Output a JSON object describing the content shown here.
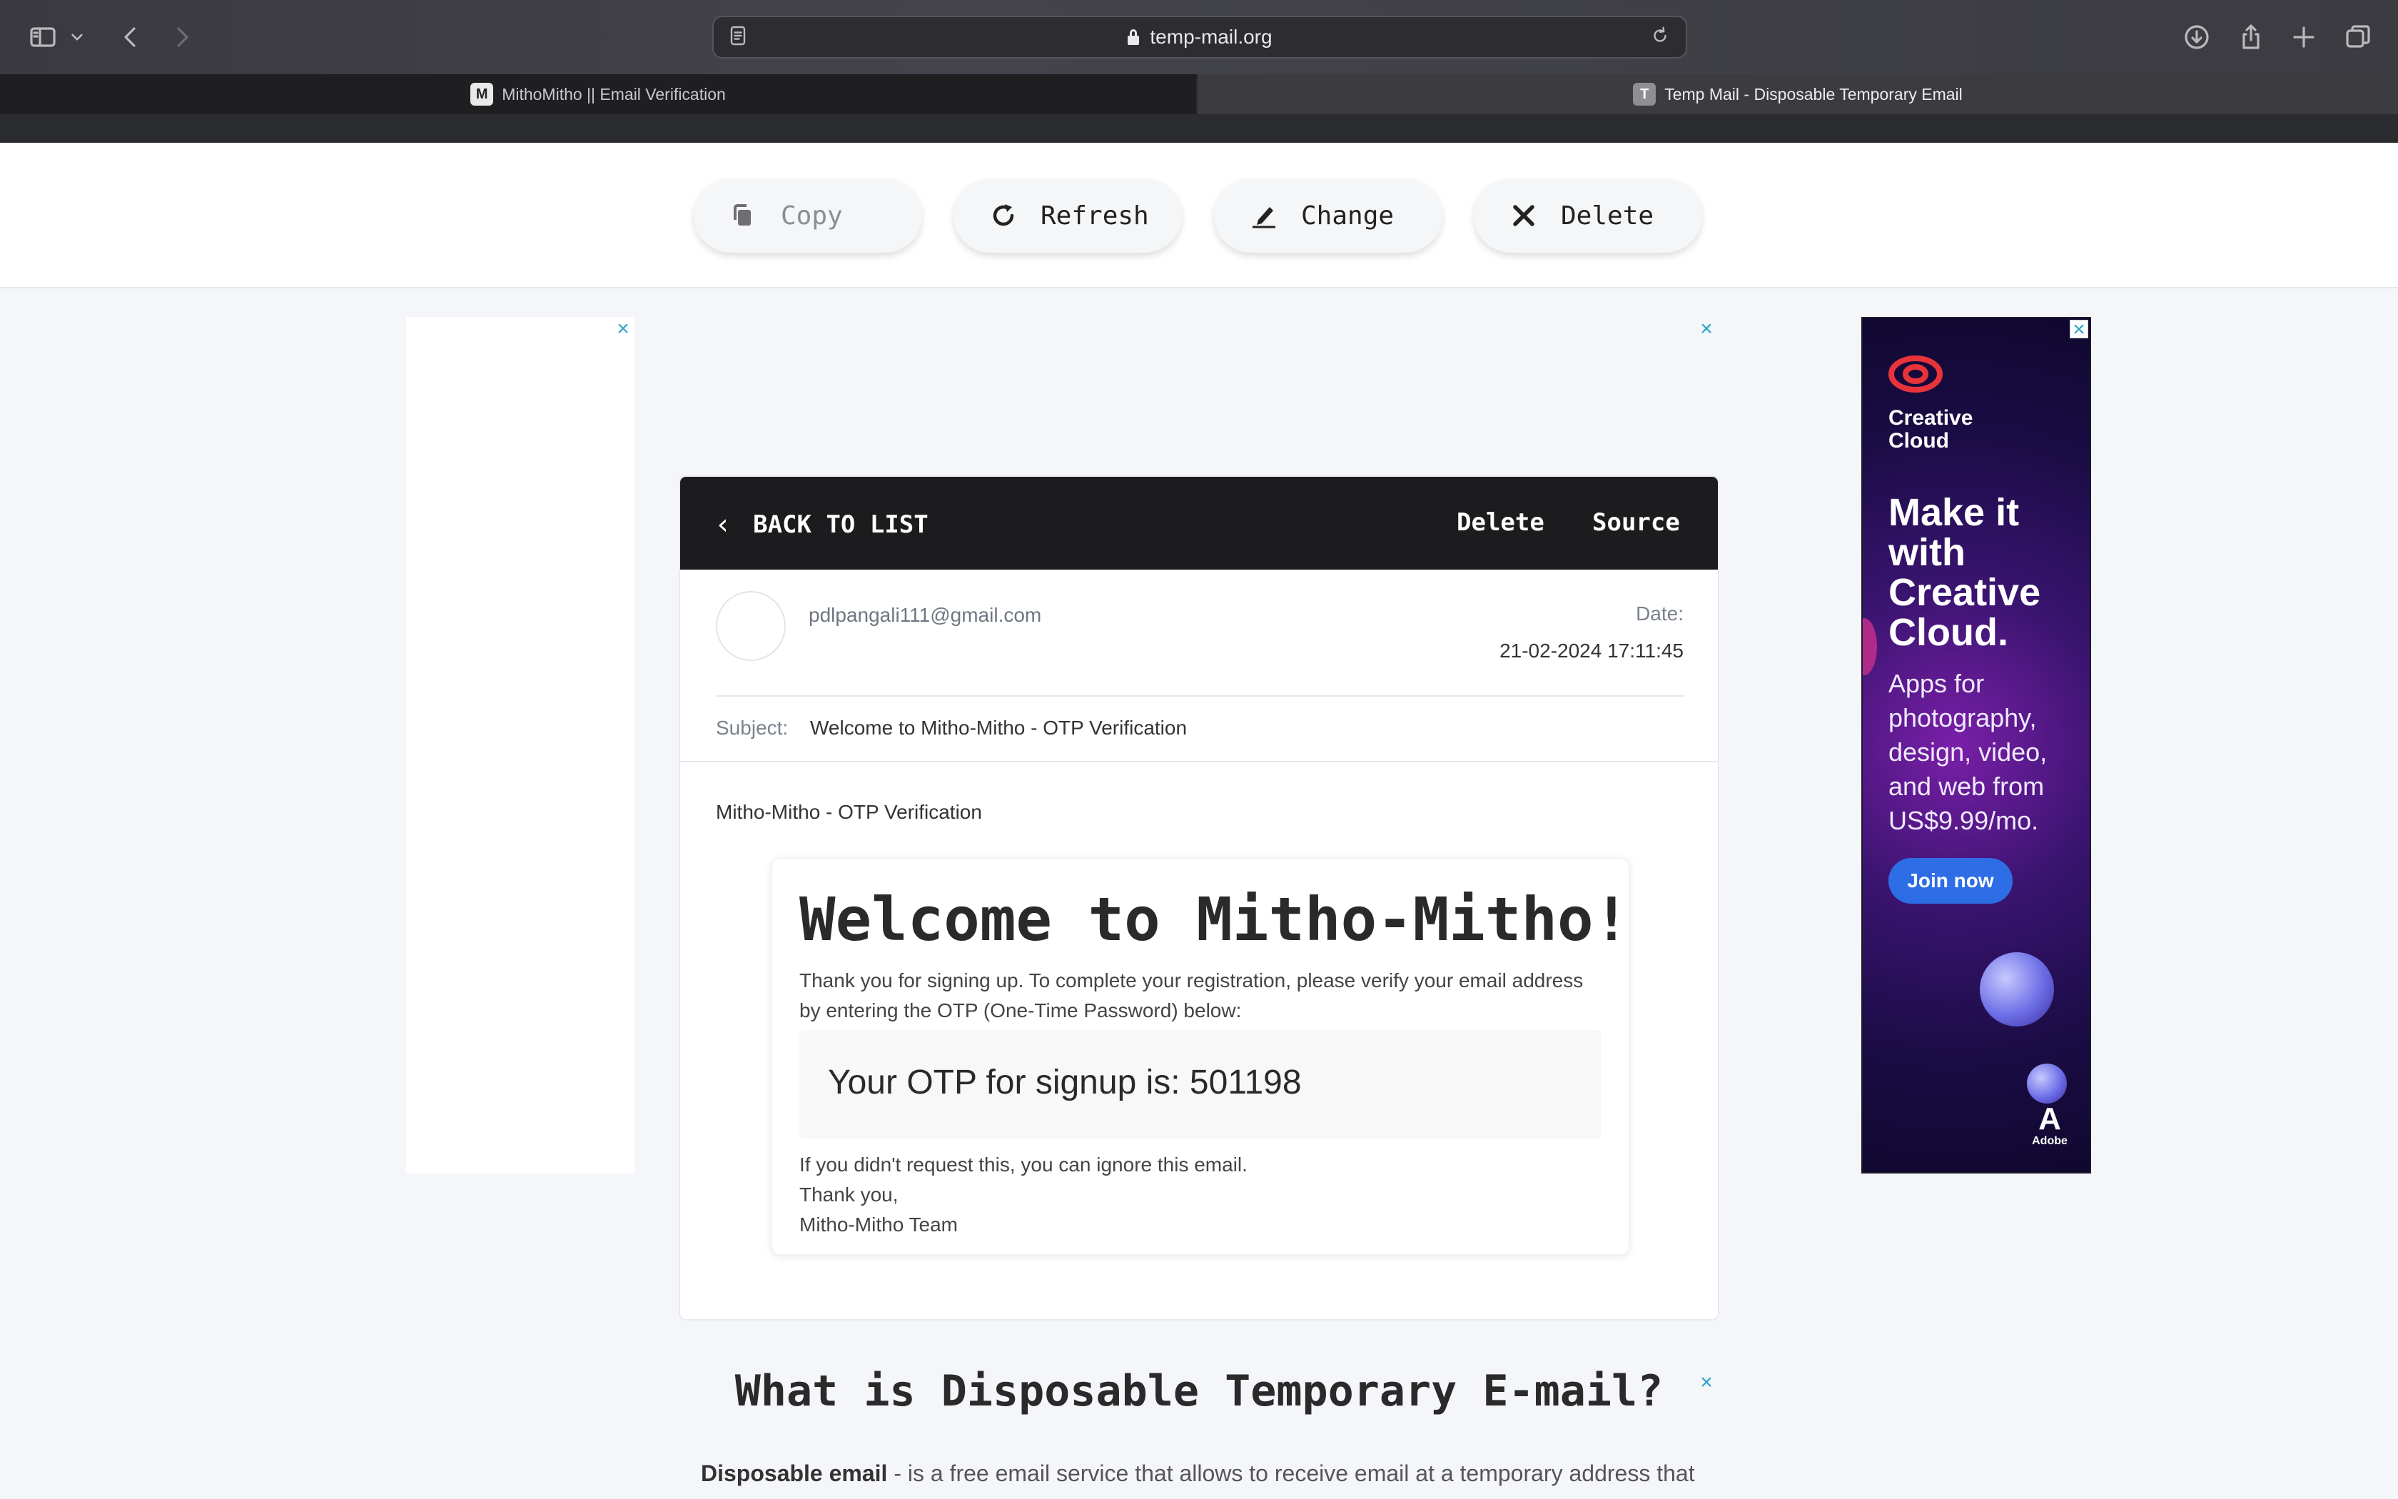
{
  "browser": {
    "url": "temp-mail.org",
    "tabs": [
      {
        "label": "MithoMitho || Email Verification",
        "favicon": "M"
      },
      {
        "label": "Temp Mail - Disposable Temporary Email",
        "favicon": "T"
      }
    ],
    "icons": {
      "sidebar": "sidebar-icon",
      "back": "back-arrow-icon",
      "forward": "forward-arrow-icon",
      "reader": "reader-icon",
      "reload": "reload-icon",
      "download": "download-icon",
      "share": "share-icon",
      "new_tab": "plus-icon",
      "tab_overview": "tabs-icon"
    }
  },
  "actions": {
    "copy": "Copy",
    "refresh": "Refresh",
    "change": "Change",
    "delete": "Delete"
  },
  "mail": {
    "back_label": "BACK TO LIST",
    "delete_label": "Delete",
    "source_label": "Source",
    "sender": "pdlpangali111@gmail.com",
    "date_label": "Date:",
    "date_value": "21-02-2024 17:11:45",
    "subject_label": "Subject:",
    "subject_value": "Welcome to Mitho-Mitho - OTP Verification",
    "preheader": "Mitho-Mitho - OTP Verification",
    "body": {
      "heading": "Welcome to Mitho-Mitho!",
      "intro": "Thank you for signing up. To complete your registration, please verify your email address by entering the OTP (One-Time Password) below:",
      "otp": "Your OTP for signup is: 501198",
      "outro_1": "If you didn't request this, you can ignore this email.",
      "outro_2": "Thank you,",
      "outro_3": "Mitho-Mitho Team"
    }
  },
  "ad": {
    "brand": "Creative Cloud",
    "brand_line1": "Creative",
    "brand_line2": "Cloud",
    "headline": "Make it with Creative Cloud.",
    "sub": "Apps for photography, design, video, and web from US$9.99/mo.",
    "cta": "Join now",
    "maker": "Adobe"
  },
  "section": {
    "title": "What is Disposable Temporary E-mail?",
    "lead_bold": "Disposable email",
    "lead_text": " - is a free email service that allows to receive email at a temporary address that"
  },
  "colors": {
    "accent_link": "#2aa5c5",
    "header_dark": "#1c1c1e",
    "cta_blue": "#2d6de6"
  }
}
